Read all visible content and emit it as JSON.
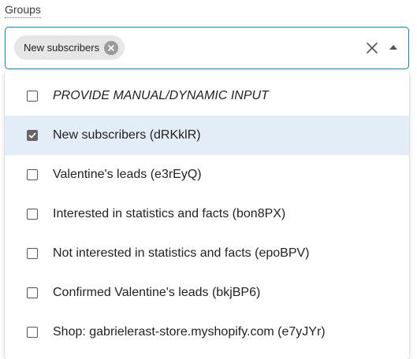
{
  "field": {
    "label": "Groups"
  },
  "select": {
    "chips": [
      {
        "label": "New subscribers"
      }
    ]
  },
  "options": [
    {
      "label": "PROVIDE MANUAL/DYNAMIC INPUT",
      "checked": false,
      "selected": false,
      "italic": true
    },
    {
      "label": "New subscribers (dRKklR)",
      "checked": true,
      "selected": true,
      "italic": false
    },
    {
      "label": "Valentine's leads (e3rEyQ)",
      "checked": false,
      "selected": false,
      "italic": false
    },
    {
      "label": "Interested in statistics and facts (bon8PX)",
      "checked": false,
      "selected": false,
      "italic": false
    },
    {
      "label": "Not interested in statistics and facts (epoBPV)",
      "checked": false,
      "selected": false,
      "italic": false
    },
    {
      "label": "Confirmed Valentine's leads (bkjBP6)",
      "checked": false,
      "selected": false,
      "italic": false
    },
    {
      "label": "Shop: gabrielerast-store.myshopify.com (e7yJYr)",
      "checked": false,
      "selected": false,
      "italic": false
    }
  ],
  "colors": {
    "focus_border": "#1c7fa6",
    "selected_row": "#e3edf8",
    "chip_bg": "#e6e6e6"
  },
  "icons": [
    "clear-icon",
    "caret-up-icon",
    "chip-remove-icon",
    "checkbox-checked-icon",
    "checkbox-empty-icon"
  ]
}
